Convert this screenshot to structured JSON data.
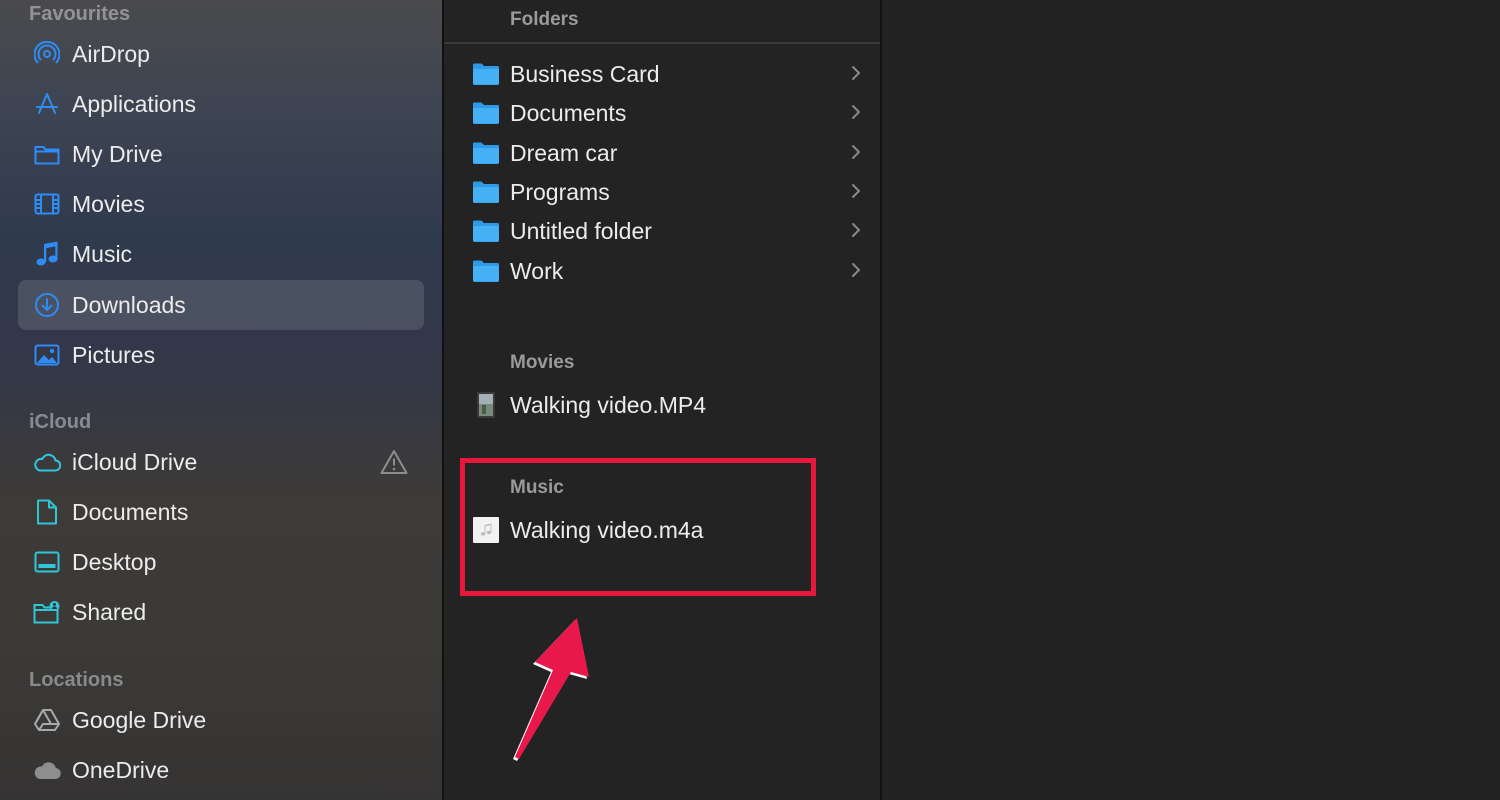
{
  "sidebar": {
    "sections": {
      "favourites": "Favourites",
      "icloud": "iCloud",
      "locations": "Locations"
    },
    "favourites": [
      {
        "label": "AirDrop",
        "icon": "airdrop-icon"
      },
      {
        "label": "Applications",
        "icon": "applications-icon"
      },
      {
        "label": "My Drive",
        "icon": "folder-icon"
      },
      {
        "label": "Movies",
        "icon": "film-icon"
      },
      {
        "label": "Music",
        "icon": "music-note-icon"
      },
      {
        "label": "Downloads",
        "icon": "download-icon",
        "selected": true
      },
      {
        "label": "Pictures",
        "icon": "photo-icon"
      }
    ],
    "icloud": [
      {
        "label": "iCloud Drive",
        "icon": "cloud-icon",
        "warning": true
      },
      {
        "label": "Documents",
        "icon": "document-icon"
      },
      {
        "label": "Desktop",
        "icon": "desktop-icon"
      },
      {
        "label": "Shared",
        "icon": "shared-folder-icon"
      }
    ],
    "locations": [
      {
        "label": "Google Drive",
        "icon": "google-drive-icon"
      },
      {
        "label": "OneDrive",
        "icon": "cloud-icon"
      }
    ]
  },
  "column": {
    "folders_header": "Folders",
    "folders": [
      {
        "name": "Business Card"
      },
      {
        "name": "Documents"
      },
      {
        "name": "Dream car"
      },
      {
        "name": "Programs"
      },
      {
        "name": "Untitled folder"
      },
      {
        "name": "Work"
      }
    ],
    "movies_header": "Movies",
    "movies": [
      {
        "name": "Walking video.MP4"
      }
    ],
    "music_header": "Music",
    "music": [
      {
        "name": "Walking video.m4a"
      }
    ]
  },
  "colors": {
    "accent": "#2f8cf5",
    "highlight": "#e8183c",
    "folder": "#3aa8f0"
  }
}
